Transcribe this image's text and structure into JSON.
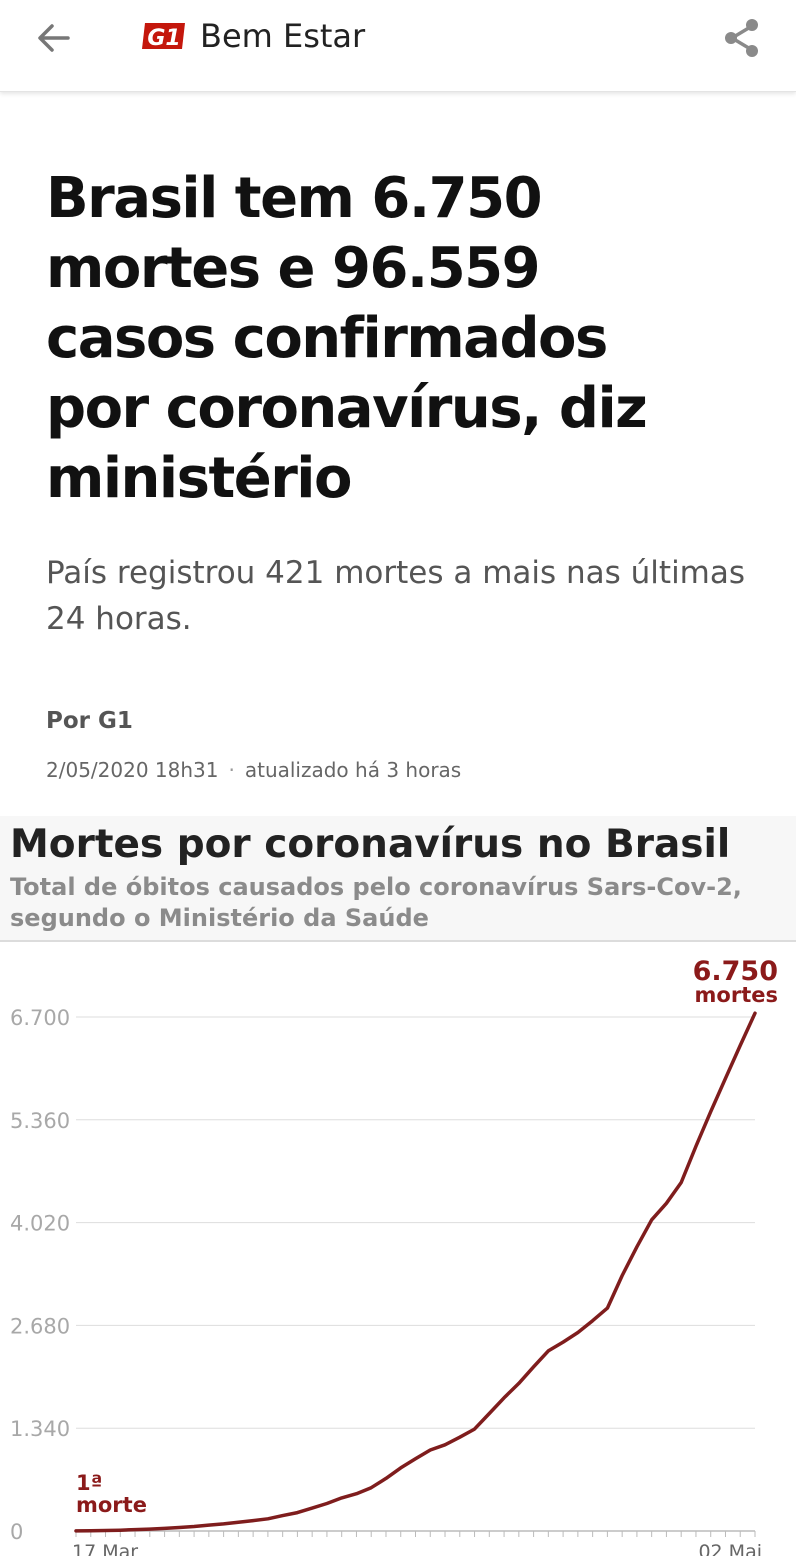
{
  "appbar": {
    "back_icon": "arrow-left-icon",
    "logo_text": "G1",
    "section": "Bem Estar",
    "share_icon": "share-icon"
  },
  "article": {
    "headline": "Brasil tem 6.750 mortes e 96.559 casos confirmados por coronavírus, diz ministério",
    "subtitle": "País registrou 421 mortes a mais nas últimas 24 horas.",
    "byline": "Por G1",
    "published": "2/05/2020 18h31",
    "separator": "·",
    "updated": "atualizado há 3 horas"
  },
  "colors": {
    "brand_red": "#c4170c",
    "line": "#7f1d1d",
    "accent_text": "#8b1a1a"
  },
  "chart_data": {
    "type": "line",
    "title": "Mortes por coronavírus no Brasil",
    "subtitle": "Total de óbitos causados pelo coronavírus Sars-Cov-2, segundo o Ministério da Saúde",
    "ylim": [
      0,
      6700
    ],
    "yticks": [
      0,
      1340,
      2680,
      4020,
      5360,
      6700
    ],
    "ytick_labels": [
      "0",
      "1.340",
      "2.680",
      "4.020",
      "5.360",
      "6.700"
    ],
    "x_labels": {
      "first": "17 Mar",
      "last": "02 Mai"
    },
    "grid": true,
    "annotations": {
      "first": {
        "line1": "1ª",
        "line2": "morte"
      },
      "last": {
        "value": "6.750",
        "label": "mortes"
      }
    },
    "series": [
      {
        "values": [
          1,
          3,
          7,
          11,
          18,
          25,
          34,
          46,
          59,
          77,
          92,
          114,
          136,
          159,
          201,
          240,
          299,
          359,
          431,
          486,
          564,
          686,
          823,
          941,
          1056,
          1124,
          1223,
          1328,
          1532,
          1736,
          1924,
          2141,
          2347,
          2462,
          2587,
          2741,
          2906,
          3331,
          3704,
          4057,
          4271,
          4543,
          5017,
          5466,
          5901,
          6329,
          6750
        ]
      }
    ]
  }
}
